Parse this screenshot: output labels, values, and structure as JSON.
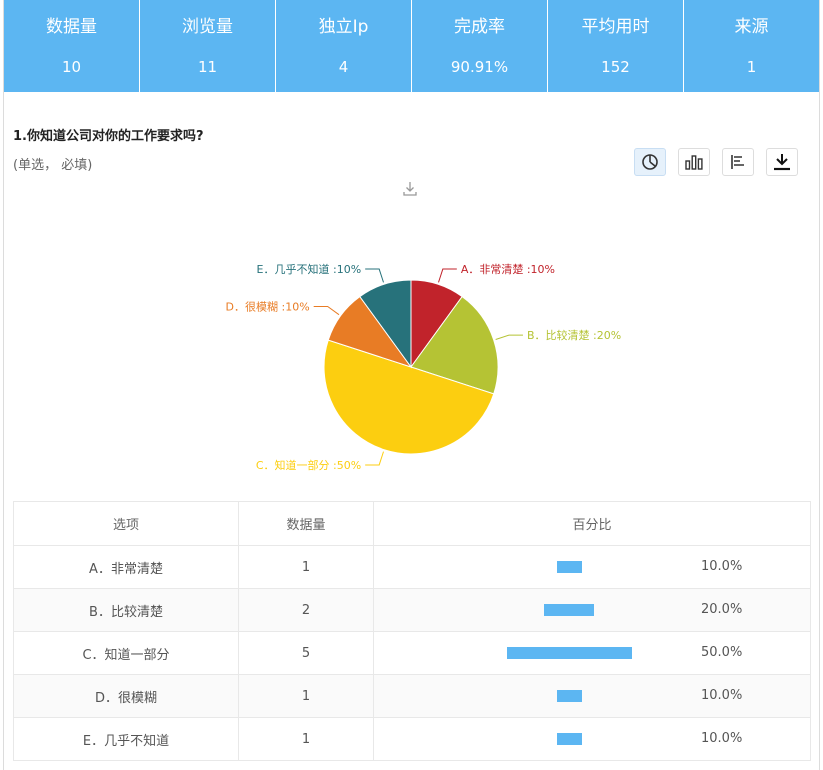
{
  "stats": [
    {
      "label": "数据量",
      "value": "10"
    },
    {
      "label": "浏览量",
      "value": "11"
    },
    {
      "label": "独立Ip",
      "value": "4"
    },
    {
      "label": "完成率",
      "value": "90.91%"
    },
    {
      "label": "平均用时",
      "value": "152"
    },
    {
      "label": "来源",
      "value": "1"
    }
  ],
  "question": {
    "title": "1.你知道公司对你的工作要求吗?",
    "subtitle": "(单选， 必填)"
  },
  "toolbar": {
    "icons": [
      "pie-chart-icon",
      "bar-chart-icon",
      "horizontal-bar-icon",
      "download-icon"
    ],
    "active": "pie-chart-icon"
  },
  "table": {
    "headers": [
      "选项",
      "数据量",
      "百分比"
    ],
    "rows": [
      {
        "option": "A．非常清楚",
        "count": "1",
        "percent": "10.0%",
        "fraction": 0.1
      },
      {
        "option": "B．比较清楚",
        "count": "2",
        "percent": "20.0%",
        "fraction": 0.2
      },
      {
        "option": "C．知道一部分",
        "count": "5",
        "percent": "50.0%",
        "fraction": 0.5
      },
      {
        "option": "D．很模糊",
        "count": "1",
        "percent": "10.0%",
        "fraction": 0.1
      },
      {
        "option": "E．几乎不知道",
        "count": "1",
        "percent": "10.0%",
        "fraction": 0.1
      }
    ]
  },
  "chart_data": {
    "type": "pie",
    "slices": [
      {
        "label": "A．非常清楚 :10%",
        "value": 10,
        "color": "#c1232b"
      },
      {
        "label": "B．比较清楚 :20%",
        "value": 20,
        "color": "#b5c334"
      },
      {
        "label": "C．知道一部分 :50%",
        "value": 50,
        "color": "#fcce10"
      },
      {
        "label": "D．很模糊 :10%",
        "value": 10,
        "color": "#e87c25"
      },
      {
        "label": "E．几乎不知道 :10%",
        "value": 10,
        "color": "#27727b"
      }
    ]
  }
}
